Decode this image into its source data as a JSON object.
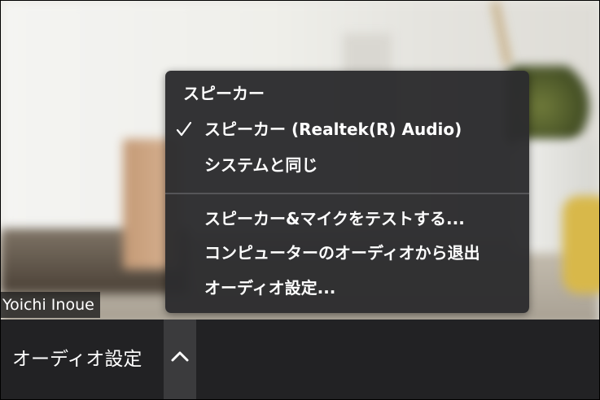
{
  "participant": {
    "name": "Yoichi Inoue"
  },
  "menu": {
    "section_title": "スピーカー",
    "items": [
      {
        "label": "スピーカー (Realtek(R) Audio)",
        "checked": true
      },
      {
        "label": "システムと同じ",
        "checked": false
      }
    ],
    "actions": [
      {
        "label": "スピーカー&マイクをテストする..."
      },
      {
        "label": "コンピューターのオーディオから退出"
      },
      {
        "label": "オーディオ設定..."
      }
    ]
  },
  "toolbar": {
    "audio_label": "オーディオ設定",
    "caret_icon": "chevron-up-icon"
  },
  "colors": {
    "menu_bg": "#2c2c2e",
    "toolbar_bg": "#222224",
    "caret_bg": "#3b3b3d",
    "text": "#ffffff"
  }
}
